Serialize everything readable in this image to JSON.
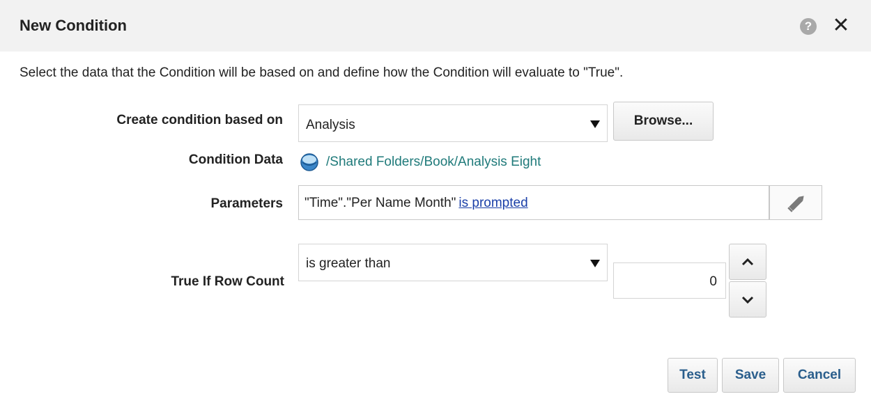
{
  "dialog": {
    "title": "New Condition",
    "help_icon": "help-icon",
    "close_icon": "close-icon",
    "instructions": "Select the data that the Condition will be based on and define how the Condition will evaluate to \"True\"."
  },
  "form": {
    "based_on_label": "Create condition based on",
    "based_on_value": "Analysis",
    "browse_label": "Browse...",
    "condition_data_label": "Condition Data",
    "condition_data_icon": "analysis-icon",
    "condition_data_path": "/Shared Folders/Book/Analysis Eight",
    "parameters_label": "Parameters",
    "parameters_text": "\"Time\".\"Per Name Month\"",
    "parameters_link": "is prompted",
    "parameters_edit_icon": "pencil-icon",
    "row_count_label": "True If Row Count",
    "row_count_operator": "is greater than",
    "row_count_value": "0"
  },
  "footer": {
    "test_label": "Test",
    "save_label": "Save",
    "cancel_label": "Cancel"
  },
  "colors": {
    "titlebar_bg": "#f2f2f2",
    "link_teal": "#1f7a7a",
    "link_blue": "#1a3fa8",
    "button_text_blue": "#2a5e8c"
  }
}
